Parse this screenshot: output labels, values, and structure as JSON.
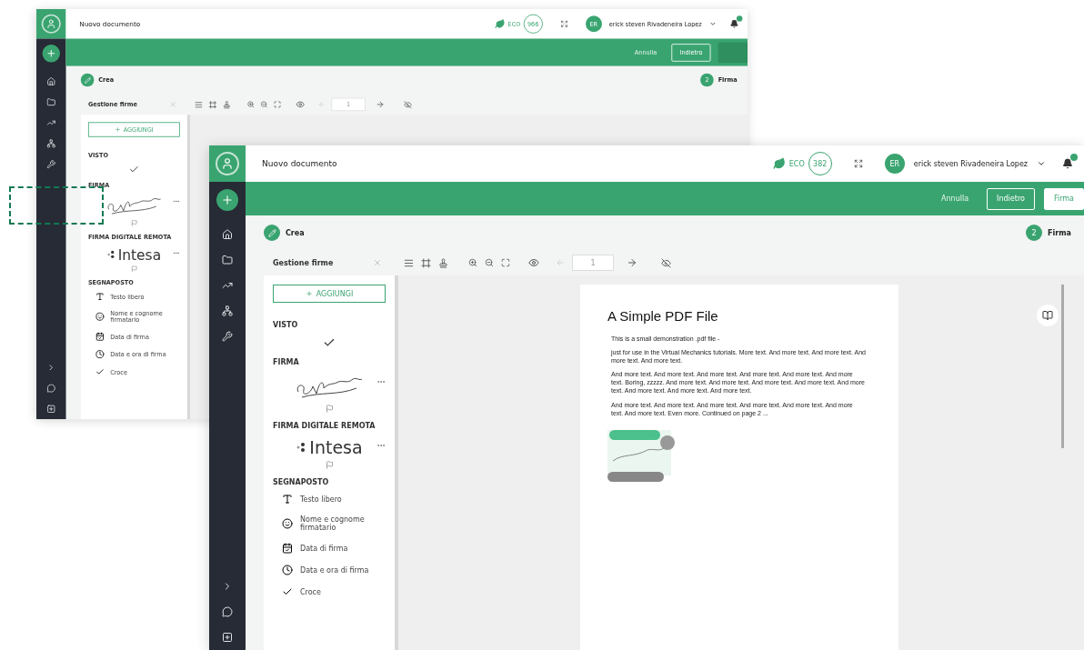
{
  "windows": [
    {
      "title": "Nuovo documento",
      "eco": {
        "label": "ECO",
        "count": "966"
      },
      "user": {
        "initials": "ER",
        "name": "erick steven Rivadeneira Lopez"
      },
      "actions": [
        {
          "label": "Annulla",
          "kind": "text"
        },
        {
          "label": "Indietro",
          "kind": "outline"
        },
        {
          "kind": "blank"
        }
      ],
      "steps": [
        {
          "label": "Crea",
          "kind": "done"
        },
        {
          "label": "Firma",
          "kind": "number",
          "number": "2"
        }
      ],
      "toolbar": {
        "title": "Gestione firme",
        "page": "1"
      },
      "panel": {
        "add_button": "AGGIUNGI",
        "sections": [
          {
            "title": "VISTO",
            "kind": "visto"
          },
          {
            "title": "FIRMA",
            "kind": "firma"
          },
          {
            "title": "FIRMA DIGITALE REMOTA",
            "kind": "remota",
            "logo": "Intesa"
          },
          {
            "title": "SEGNAPOSTO",
            "kind": "segnaposto",
            "items": [
              {
                "label": "Testo libero",
                "kind": "text"
              },
              {
                "label": "Nome e cognome firmatario",
                "kind": "name"
              },
              {
                "label": "Data di firma",
                "kind": "date"
              },
              {
                "label": "Data e ora di firma",
                "kind": "datetime"
              },
              {
                "label": "Croce",
                "kind": "cross"
              }
            ]
          }
        ]
      }
    },
    {
      "title": "Nuovo documento",
      "eco": {
        "label": "ECO",
        "count": "382"
      },
      "user": {
        "initials": "ER",
        "name": "erick steven Rivadeneira Lopez"
      },
      "actions": [
        {
          "label": "Annulla",
          "kind": "text"
        },
        {
          "label": "Indietro",
          "kind": "outline"
        },
        {
          "label": "Firma",
          "kind": "solid"
        }
      ],
      "steps": [
        {
          "label": "Crea",
          "kind": "done"
        },
        {
          "label": "Firma",
          "kind": "number",
          "number": "2"
        }
      ],
      "toolbar": {
        "title": "Gestione firme",
        "page": "1"
      },
      "panel": {
        "add_button": "AGGIUNGI",
        "sections": [
          {
            "title": "VISTO",
            "kind": "visto"
          },
          {
            "title": "FIRMA",
            "kind": "firma"
          },
          {
            "title": "FIRMA DIGITALE REMOTA",
            "kind": "remota",
            "logo": "Intesa"
          },
          {
            "title": "SEGNAPOSTO",
            "kind": "segnaposto",
            "items": [
              {
                "label": "Testo libero",
                "kind": "text"
              },
              {
                "label": "Nome e cognome firmatario",
                "kind": "name"
              },
              {
                "label": "Data di firma",
                "kind": "date"
              },
              {
                "label": "Data e ora di firma",
                "kind": "datetime"
              },
              {
                "label": "Croce",
                "kind": "cross"
              }
            ]
          }
        ]
      },
      "document": {
        "title": "A Simple PDF File",
        "paragraphs": [
          "This is a small demonstration .pdf file -",
          "just for use in the Virtual Mechanics tutorials. More text. And more text. And more text. And more text. And more text.",
          "And more text. And more text. And more text. And more text. And more text. And more text. Boring, zzzzz. And more text. And more text. And more text. And more text. And more text. And more text. And more text. And more text.",
          "And more text. And more text. And more text. And more text. And more text. And more text. And more text. Even more. Continued on page 2 ..."
        ]
      }
    }
  ]
}
